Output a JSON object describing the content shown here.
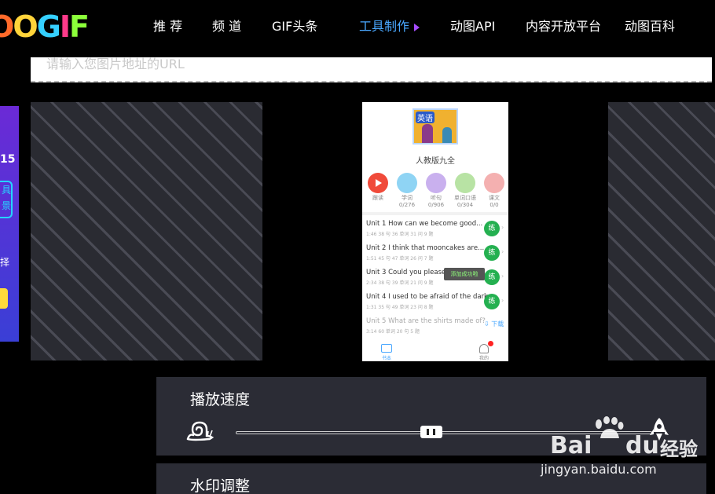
{
  "header": {
    "logo_text": "OOGIF",
    "logo_colors": [
      "#ff6a2a",
      "#ffd43a",
      "#35d0ff",
      "#ff3a8a",
      "#8cff3a"
    ],
    "nav": [
      {
        "label": "推 荐",
        "active": false
      },
      {
        "label": "频 道",
        "active": false
      },
      {
        "label": "GIF头条",
        "active": false
      },
      {
        "label": "工具制作",
        "active": true
      },
      {
        "label": "动图API",
        "active": false
      },
      {
        "label": "内容开放平台",
        "active": false
      },
      {
        "label": "动图百科",
        "active": false
      }
    ],
    "active_color": "#4aa8ff"
  },
  "url_input": {
    "placeholder": "请输入您图片地址的URL"
  },
  "promo": {
    "line1": "15",
    "line2": "具\n景",
    "line3": "择"
  },
  "preview": {
    "book_label": "英语",
    "book_title": "人教版九全",
    "circles": [
      {
        "label": "跟读",
        "sub": "",
        "color": "#f04a3a"
      },
      {
        "label": "学词",
        "sub": "0/276",
        "color": "#8fd4f4"
      },
      {
        "label": "听句",
        "sub": "0/906",
        "color": "#c9b0ee"
      },
      {
        "label": "单词口语",
        "sub": "0/304",
        "color": "#b8e3a4"
      },
      {
        "label": "课文",
        "sub": "0/0",
        "color": "#f4b0b0"
      }
    ],
    "units": [
      {
        "title": "Unit 1 How can we become good...",
        "meta": "1:46   38 句   36 单词   31 问   9 题"
      },
      {
        "title": "Unit 2 I think that mooncakes are...",
        "meta": "1:51   45 句   47 单词   26 问   7 题"
      },
      {
        "title": "Unit 3 Could you please tell ...",
        "meta": "2:34   38 句   39 单词   21 问   9 题"
      },
      {
        "title": "Unit 4 I used to be afraid of the dark.",
        "meta": "1:31   35 句   49 单词   23 问   8 题"
      },
      {
        "title": "Unit 5 What are the shirts made of?",
        "meta": "3:14   60 单词   20 句   5 题"
      }
    ],
    "practice_label": "练",
    "download_label": "下载",
    "toast": "添加成功啦",
    "tab_left": "书本",
    "tab_right": "我的"
  },
  "speed": {
    "title": "播放速度",
    "value": 0.47
  },
  "watermark_panel": {
    "title": "水印调整"
  },
  "stamp": {
    "bai": "Bai",
    "du": "du",
    "jingyan": "经验",
    "url": "jingyan.baidu.com"
  }
}
